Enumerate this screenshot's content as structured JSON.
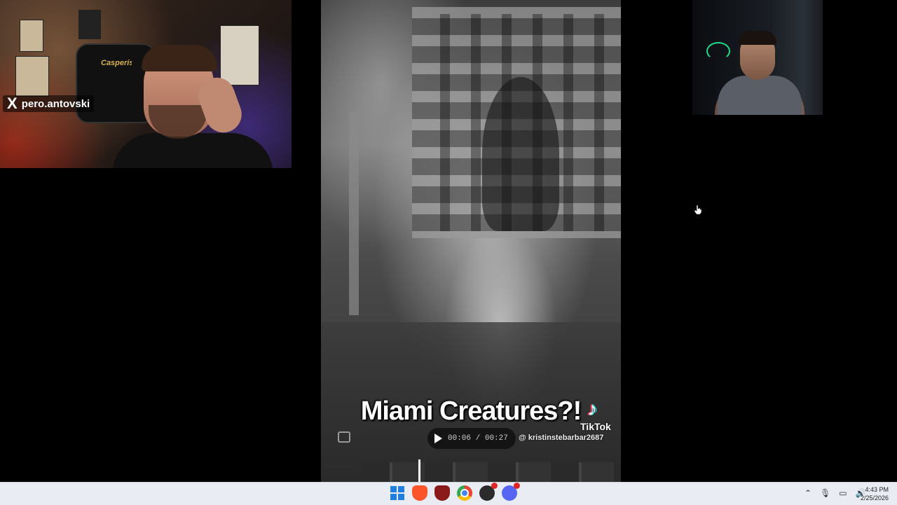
{
  "streamer_cam": {
    "social_platform_icon": "x-logo",
    "handle": "pero.antovski",
    "chair_brand": "Casperis"
  },
  "video": {
    "caption": "Miami Creatures?!",
    "watermark": "TikTok",
    "author": "@ kristinstebarbar2687",
    "current_time": "00:06",
    "total_time": "00:27",
    "time_separator": "/",
    "progress": 0.22
  },
  "taskbar": {
    "apps": [
      "windows-start-icon",
      "brave-browser-icon",
      "brave-shield-icon",
      "chrome-icon",
      "obs-icon",
      "discord-icon"
    ],
    "tray_icons": [
      "chevron-up-icon",
      "microphone-icon",
      "display-icon",
      "speaker-icon"
    ],
    "clock_time": "4:43 PM",
    "clock_date": "2/25/2026"
  },
  "colors": {
    "taskbar_bg": "#e9edf3",
    "tiktok_cyan": "#25f4ee",
    "tiktok_red": "#fe2c55",
    "discord": "#5865f2",
    "brave": "#fb542b"
  }
}
